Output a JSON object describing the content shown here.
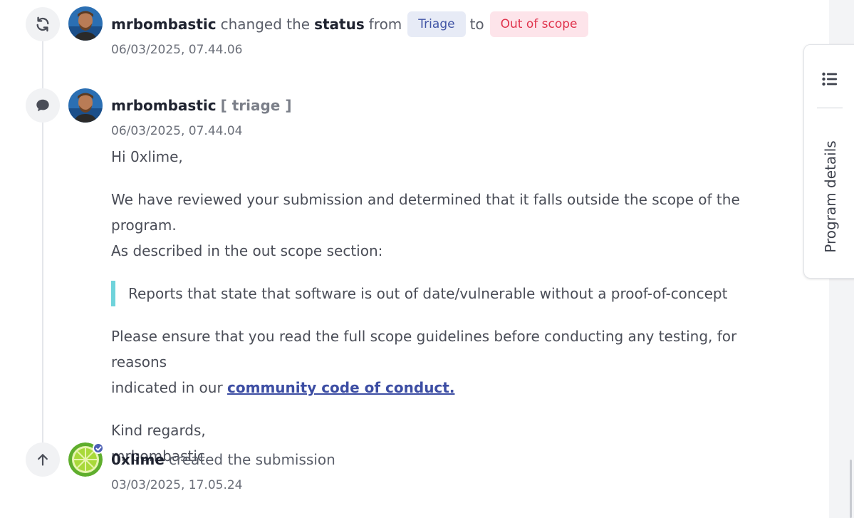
{
  "timeline": {
    "status_event": {
      "user": "mrbombastic",
      "text_changed": "changed the",
      "text_status": "status",
      "text_from": "from",
      "from_status": "Triage",
      "text_to": "to",
      "to_status": "Out of scope",
      "timestamp": "06/03/2025, 07.44.06",
      "icon": "refresh-icon"
    },
    "comment_event": {
      "user": "mrbombastic",
      "role": "[ triage ]",
      "timestamp": "06/03/2025, 07.44.04",
      "icon": "chat-bubble-icon",
      "greeting": "Hi 0xlime,",
      "paragraph1_line1": "We have reviewed your submission and determined that it falls outside the scope of the program.",
      "paragraph1_line2": "As described in the out scope section:",
      "quote": "Reports that state that software is out of date/vulnerable without a proof-of-concept",
      "paragraph2_line1": "Please ensure that you read the full scope guidelines before conducting any testing, for reasons",
      "paragraph2_prefix": "indicated in our",
      "link_text": "community code of conduct.",
      "closing": "Kind regards,",
      "signature": "mrbombastic"
    },
    "created_event": {
      "user": "0xlime",
      "text": "created the submission",
      "timestamp": "03/03/2025, 17.05.24",
      "icon": "arrow-up-icon"
    }
  },
  "side_panel": {
    "label": "Program details",
    "icon": "list-icon"
  },
  "colors": {
    "triage_chip_bg": "#e7ebf6",
    "triage_chip_text": "#4256a6",
    "oos_chip_bg": "#fde4ea",
    "oos_chip_text": "#e0344d",
    "quote_bar": "#6fd3db",
    "link": "#3c4da3"
  }
}
